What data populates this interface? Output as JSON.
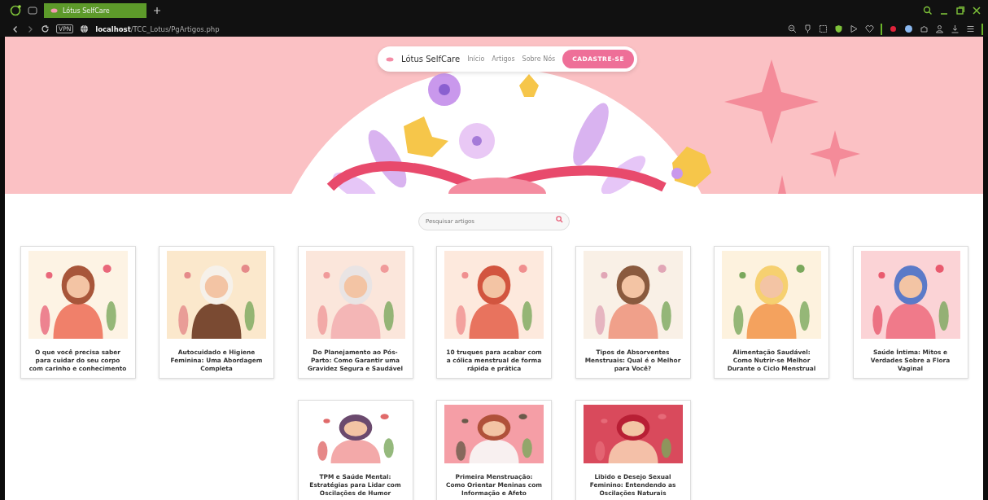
{
  "browser": {
    "tab": {
      "title": "Lótus SelfCare",
      "selected": true
    },
    "vpn": "VPN",
    "url_host": "localhost",
    "url_path": "/TCC_Lotus/PgArtigos.php"
  },
  "nav": {
    "brand": "Lótus SelfCare",
    "links": [
      "Início",
      "Artigos",
      "Sobre Nós"
    ],
    "cta": "CADASTRE-SE"
  },
  "search": {
    "placeholder": "Pesquisar artigos"
  },
  "articles": [
    {
      "title": "O que você precisa saber para cuidar do seu corpo com carinho e conhecimento"
    },
    {
      "title": "Autocuidado e Higiene Feminina: Uma Abordagem Completa"
    },
    {
      "title": "Do Planejamento ao Pós-Parto: Como Garantir uma Gravidez Segura e Saudável"
    },
    {
      "title": "10 truques para acabar com a cólica menstrual de forma rápida e prática"
    },
    {
      "title": "Tipos de Absorventes Menstruais: Qual é o Melhor para Você?"
    },
    {
      "title": "Alimentação Saudável: Como Nutrir-se Melhor Durante o Ciclo Menstrual"
    },
    {
      "title": "Saúde Íntima: Mitos e Verdades Sobre a Flora Vaginal"
    },
    {
      "title": "TPM e Saúde Mental: Estratégias para Lidar com Oscilações de Humor"
    },
    {
      "title": "Primeira Menstruação: Como Orientar Meninas com Informação e Afeto"
    },
    {
      "title": "Libido e Desejo Sexual Feminino: Entendendo as Oscilações Naturais"
    }
  ]
}
